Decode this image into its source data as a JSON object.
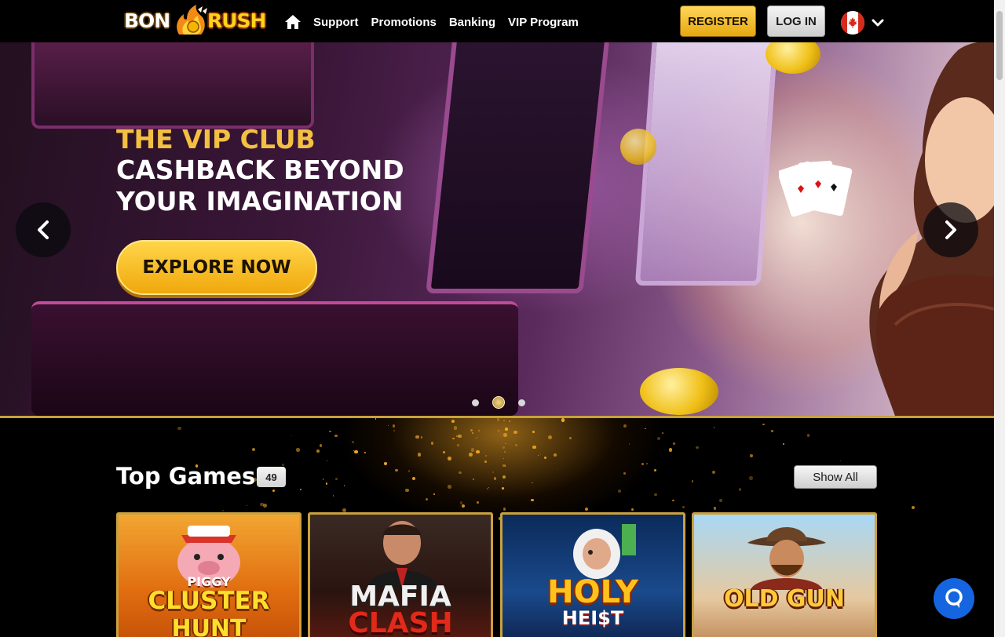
{
  "header": {
    "logo": {
      "part1": "BON",
      "part2": "RUSH"
    },
    "nav": {
      "home_icon": "home-icon",
      "items": [
        "Support",
        "Promotions",
        "Banking",
        "VIP Program"
      ]
    },
    "register_label": "REGISTER",
    "login_label": "LOG IN",
    "language": {
      "flag_icon": "canada-flag-icon",
      "caret_icon": "chevron-down-icon"
    }
  },
  "hero": {
    "title_line1": "THE VIP CLUB",
    "title_line2": "CASHBACK BEYOND",
    "title_line3": "YOUR IMAGINATION",
    "cta_label": "EXPLORE NOW",
    "prev_icon": "chevron-left-icon",
    "next_icon": "chevron-right-icon",
    "slide_count": 3,
    "active_slide": 2
  },
  "top_games": {
    "title": "Top Games",
    "count": "49",
    "show_all_label": "Show All",
    "games": [
      {
        "line1": "PIGGY",
        "line2": "CLUSTER",
        "line3": "HUNT"
      },
      {
        "line1": "MAFIA",
        "line2": "CLASH"
      },
      {
        "line1": "HOLY",
        "line2": "HEI$T"
      },
      {
        "line1": "OLD GUN"
      }
    ]
  },
  "chat": {
    "icon": "chat-bubble-icon"
  },
  "colors": {
    "accent_gold": "#f3c042",
    "chat_blue": "#1565e0"
  }
}
